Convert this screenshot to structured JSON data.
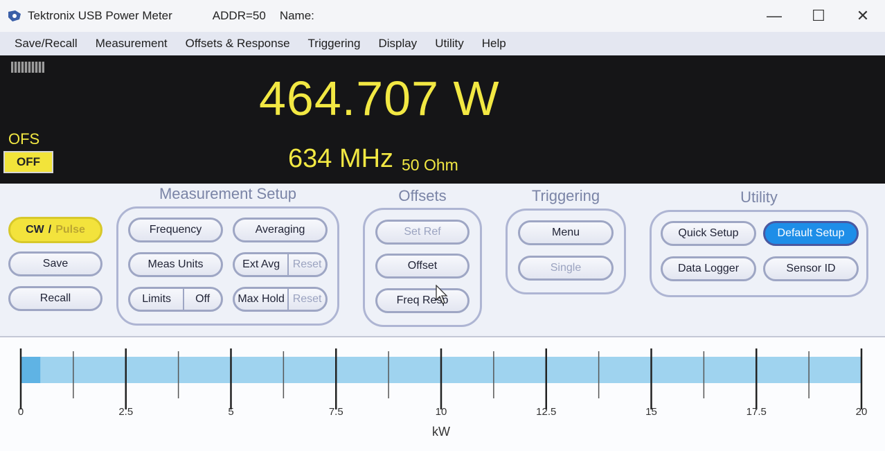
{
  "window": {
    "title": "Tektronix USB Power Meter",
    "addr": "ADDR=50",
    "name_label": "Name:",
    "minimize": "—",
    "maximize": "☐",
    "close": "✕"
  },
  "menu": [
    "Save/Recall",
    "Measurement",
    "Offsets & Response",
    "Triggering",
    "Display",
    "Utility",
    "Help"
  ],
  "display": {
    "reading": "464.707 W",
    "frequency": "634 MHz",
    "impedance": "50 Ohm",
    "ofs_label": "OFS",
    "ofs_state": "OFF"
  },
  "left_buttons": {
    "cw": "CW",
    "slash": "/",
    "pulse": "Pulse",
    "save": "Save",
    "recall": "Recall"
  },
  "measurement_setup": {
    "title": "Measurement Setup",
    "frequency": "Frequency",
    "averaging": "Averaging",
    "meas_units": "Meas Units",
    "ext_avg": "Ext Avg",
    "ext_avg_reset": "Reset",
    "limits": "Limits",
    "limits_value": "Off",
    "max_hold": "Max Hold",
    "max_hold_reset": "Reset"
  },
  "offsets": {
    "title": "Offsets",
    "set_ref": "Set Ref",
    "offset": "Offset",
    "freq_resp": "Freq Resp"
  },
  "triggering": {
    "title": "Triggering",
    "menu": "Menu",
    "single": "Single"
  },
  "utility": {
    "title": "Utility",
    "quick_setup": "Quick Setup",
    "default_setup": "Default Setup",
    "data_logger": "Data Logger",
    "sensor_id": "Sensor ID"
  },
  "scale": {
    "unit": "kW",
    "min": 0,
    "max": 20,
    "major_ticks": [
      "0",
      "2.5",
      "5",
      "7.5",
      "10",
      "12.5",
      "15",
      "17.5",
      "20"
    ],
    "level_kw": 0.464707
  },
  "colors": {
    "reading": "#f2e843",
    "bar": "#9fd3ef",
    "accent_blue": "#1e8ee8",
    "accent_yellow": "#f3e33c"
  }
}
